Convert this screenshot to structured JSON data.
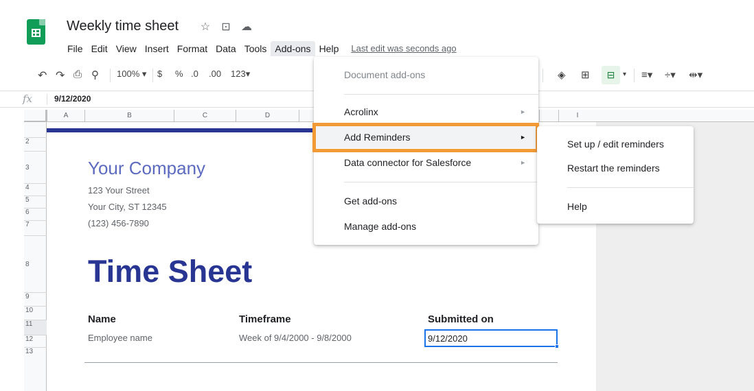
{
  "doc": {
    "title": "Weekly time sheet",
    "last_edit": "Last edit was seconds ago"
  },
  "menubar": [
    "File",
    "Edit",
    "View",
    "Insert",
    "Format",
    "Data",
    "Tools",
    "Add-ons",
    "Help"
  ],
  "toolbar": {
    "zoom": "100%",
    "currency": "$",
    "percent": "%",
    "dec_less": ".0",
    "dec_more": ".00",
    "format_more": "123"
  },
  "formula_bar": {
    "fx": "fx",
    "value": "9/12/2020"
  },
  "columns": [
    "A",
    "B",
    "C",
    "D",
    "I"
  ],
  "rows": [
    "2",
    "3",
    "4",
    "5",
    "6",
    "7",
    "8",
    "9",
    "10",
    "11",
    "12",
    "13"
  ],
  "sheet": {
    "company": "Your Company",
    "street": "123 Your Street",
    "city": "Your City, ST 12345",
    "phone": "(123) 456-7890",
    "title": "Time Sheet",
    "name_label": "Name",
    "timeframe_label": "Timeframe",
    "submitted_label": "Submitted on",
    "name_value": "Employee name",
    "timeframe_value": "Week of 9/4/2000 - 9/8/2000",
    "submitted_value": "9/12/2020"
  },
  "addons_menu": {
    "document_addons": "Document add-ons",
    "acrolinx": "Acrolinx",
    "add_reminders": "Add Reminders",
    "salesforce": "Data connector for Salesforce",
    "get_addons": "Get add-ons",
    "manage_addons": "Manage add-ons"
  },
  "reminders_menu": {
    "setup": "Set up / edit reminders",
    "restart": "Restart the reminders",
    "help": "Help"
  },
  "colors": {
    "highlight": "#f29a36",
    "brand_blue": "#283593",
    "company_purple": "#5c6bc0",
    "selection_blue": "#1a73e8"
  }
}
